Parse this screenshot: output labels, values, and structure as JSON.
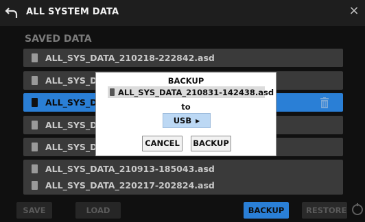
{
  "header": {
    "title": "ALL SYSTEM DATA"
  },
  "section": {
    "title": "SAVED DATA"
  },
  "files": [
    {
      "name": "ALL_SYS_DATA_210218-222842.asd",
      "selected": false
    },
    {
      "name": "ALL_SYS_DA",
      "selected": false
    },
    {
      "name": "ALL_SYS_DA",
      "selected": true
    },
    {
      "name": "ALL_SYS_DA",
      "selected": false
    },
    {
      "name": "ALL_SYS_DA",
      "selected": false
    },
    {
      "name": "ALL_SYS_DATA_210913-185043.asd",
      "selected": false
    },
    {
      "name": "ALL_SYS_DATA_220217-202824.asd",
      "selected": false
    }
  ],
  "bottom": {
    "save": "SAVE",
    "load": "LOAD",
    "backup": "BACKUP",
    "restore": "RESTORE"
  },
  "modal": {
    "title": "BACKUP",
    "file": "ALL_SYS_DATA_210831-142438.asd",
    "to_label": "to",
    "destination": "USB",
    "cancel": "CANCEL",
    "confirm": "BACKUP"
  },
  "icons": {
    "back": "back-arrow-icon",
    "close": "close-icon",
    "trash": "trash-icon",
    "usb_arrow": "triangle-right-icon",
    "knob": "encoder-knob-icon"
  },
  "colors": {
    "accent": "#2a7fd6",
    "row_bg": "#3a3a3a",
    "modal_select": "#bcd8f4"
  }
}
